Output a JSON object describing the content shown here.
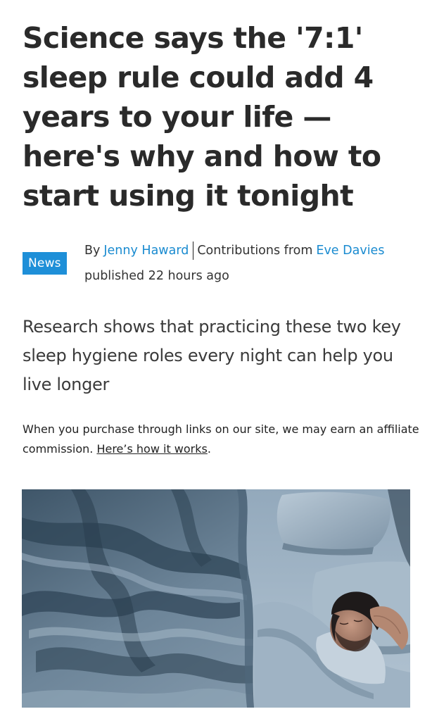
{
  "article": {
    "headline": "Science says the '7:1' sleep rule could add 4 years to your life — here's why and how to start using it tonight",
    "category_badge": "News",
    "byline": {
      "prefix": "By",
      "author": "Jenny Haward",
      "contributions_prefix": "Contributions from",
      "contributor": "Eve Davies",
      "published": "published 22 hours ago"
    },
    "standfirst": "Research shows that practicing these two key sleep hygiene roles every night can help you live longer",
    "disclaimer": {
      "text": "When you purchase through links on our site, we may earn an affiliate commission.",
      "link_label": "Here’s how it works",
      "suffix": "."
    },
    "hero_image": {
      "subject": "man sleeping in bed under blue sheets"
    }
  },
  "colors": {
    "badge_background": "#1e8fd8",
    "link": "#1a8bd0",
    "headline_text": "#2a2a2a"
  }
}
